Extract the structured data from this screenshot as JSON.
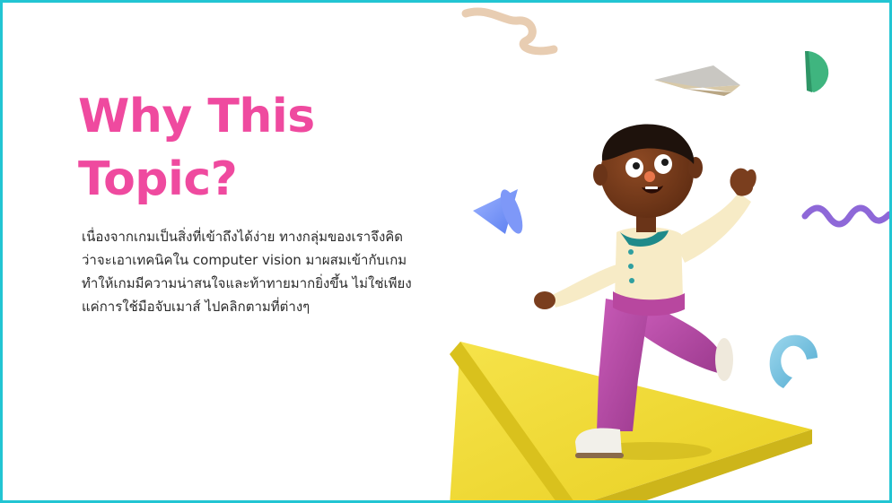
{
  "slide": {
    "title": "Why This Topic?",
    "body": "เนื่องจากเกมเป็นสิ่งที่เข้าถึงได้ง่าย ทางกลุ่มของเราจึงคิดว่าจะเอาเทคนิคใน computer vision มาผสมเข้ากับเกม ทำให้เกมมีความน่าสนใจและท้าทายมากยิ่งขึ้น ไม่ใช่เพียงแค่การใช้มือจับเมาส์ ไปคลิกตามที่ต่างๆ"
  },
  "colors": {
    "border": "#22c5d3",
    "title": "#ef4a9f",
    "body_text": "#2b2b2b",
    "platform": "#f1dc2c",
    "pants": "#c04fae",
    "shirt": "#f7ebc6",
    "skin": "#7a3e1e"
  },
  "illustration": {
    "character": "running-cartoon-boy",
    "shapes": [
      "beige-squiggle",
      "paper-plane",
      "green-half-circle",
      "blue-cone",
      "purple-wave",
      "blue-magnet-arc",
      "yellow-triangle-platform"
    ]
  }
}
